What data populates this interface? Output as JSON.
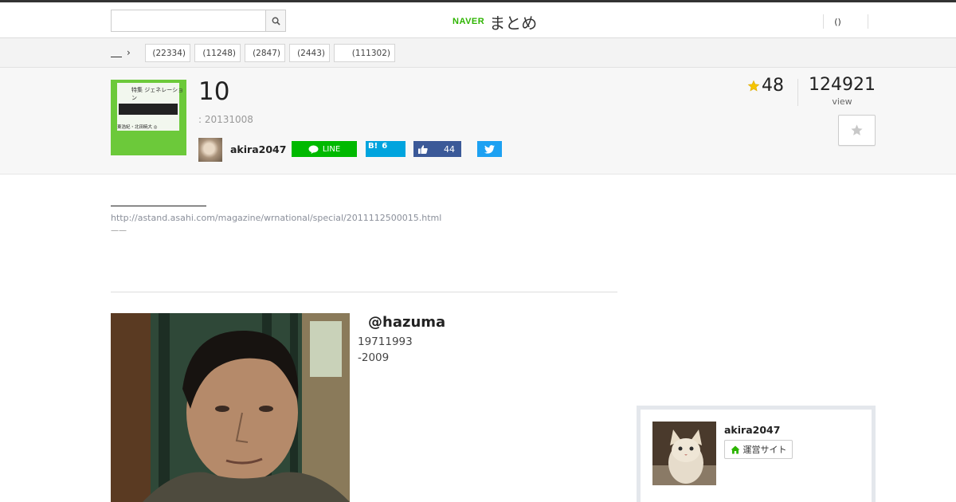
{
  "header": {
    "logo_naver": "NAVER",
    "logo_matome": "まとめ",
    "search_placeholder": "",
    "right_link": "()"
  },
  "categories": {
    "items": [
      {
        "label": "(22334)"
      },
      {
        "label": "(11248)"
      },
      {
        "label": "(2847)"
      },
      {
        "label": "(2443)"
      },
      {
        "label": "(111302)"
      }
    ]
  },
  "summary": {
    "title": "10",
    "date": ": 20131008",
    "thumbnail_title": "特集 ジェネレーション",
    "thumbnail_authors": "東浩紀・北田暁大 ◎",
    "author_name": "akira2047",
    "line_label": "LINE",
    "hatena_count": "6",
    "hatena_label": "B!",
    "fb_count": "44",
    "star_count": "48",
    "view_count": "124921",
    "view_label": "view"
  },
  "content": {
    "source_url": "http://astand.asahi.com/magazine/wrnational/special/2011112500015.html",
    "dashes": "——",
    "person_name": "@hazuma",
    "person_years": "19711993",
    "person_note": "-2009"
  },
  "sidebar": {
    "curator_name": "akira2047",
    "site_button": "運営サイト"
  },
  "colors": {
    "line_green": "#00b900",
    "hatena_blue": "#00a4de",
    "facebook_blue": "#3b5998",
    "twitter_blue": "#1da1f2",
    "naver_green": "#2db400",
    "star_gold": "#f5c400",
    "link_gray": "#8a8f9a"
  }
}
